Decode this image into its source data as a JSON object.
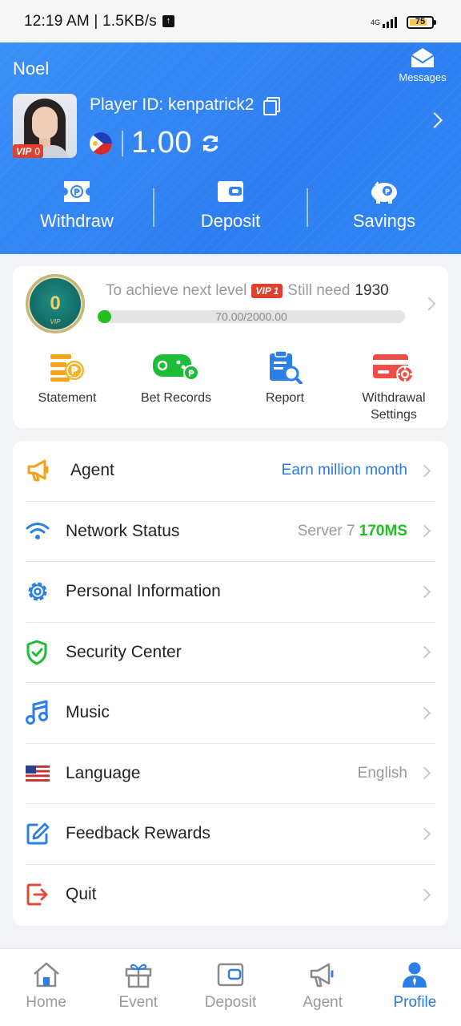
{
  "status_bar": {
    "time": "12:19 AM | 1.5KB/s",
    "network": "4G",
    "battery": "75"
  },
  "header": {
    "user_name": "Noel",
    "messages_label": "Messages",
    "player_id": "Player ID: kenpatrick2",
    "vip_label": "VIP",
    "vip_level": "0",
    "balance": "1.00",
    "actions": [
      {
        "label": "Withdraw",
        "icon": "withdraw-icon"
      },
      {
        "label": "Deposit",
        "icon": "wallet-icon"
      },
      {
        "label": "Savings",
        "icon": "piggy-bank-icon"
      }
    ]
  },
  "level_card": {
    "badge_level": "0",
    "badge_sub": "VIP",
    "prefix": "To achieve next level",
    "next_vip_label": "VIP 1",
    "still_need": "Still need",
    "need_amount": "1930",
    "progress_text": "70.00/2000.00",
    "progress_fraction": 0.035,
    "quick_actions": [
      {
        "label": "Statement",
        "icon": "statement-icon"
      },
      {
        "label": "Bet Records",
        "icon": "gamepad-icon"
      },
      {
        "label": "Report",
        "icon": "report-icon"
      },
      {
        "label": "Withdrawal\nSettings",
        "icon": "card-settings-icon"
      }
    ]
  },
  "menu": [
    {
      "label": "Agent",
      "value": "Earn million month",
      "icon": "megaphone-icon"
    },
    {
      "label": "Network Status",
      "value": "Server 7",
      "value_highlight": "170MS",
      "icon": "wifi-icon"
    },
    {
      "label": "Personal Information",
      "value": "",
      "icon": "gear-icon"
    },
    {
      "label": "Security Center",
      "value": "",
      "icon": "shield-icon"
    },
    {
      "label": "Music",
      "value": "",
      "icon": "music-icon"
    },
    {
      "label": "Language",
      "value": "English",
      "icon": "us-flag-icon"
    },
    {
      "label": "Feedback Rewards",
      "value": "",
      "icon": "edit-icon"
    },
    {
      "label": "Quit",
      "value": "",
      "icon": "logout-icon"
    }
  ],
  "bottom_nav": [
    {
      "label": "Home",
      "icon": "home-icon",
      "active": false
    },
    {
      "label": "Event",
      "icon": "gift-icon",
      "active": false
    },
    {
      "label": "Deposit",
      "icon": "wallet-icon",
      "active": false
    },
    {
      "label": "Agent",
      "icon": "megaphone-icon",
      "active": false
    },
    {
      "label": "Profile",
      "icon": "user-icon",
      "active": true
    }
  ],
  "colors": {
    "primary": "#2f83f4",
    "vip_red": "#e0412f",
    "progress_green": "#20c020",
    "link_blue": "#2a79dc"
  }
}
